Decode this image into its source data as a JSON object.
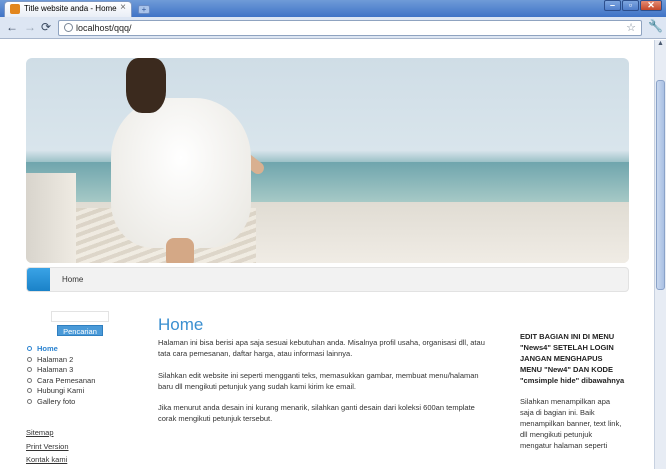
{
  "browser": {
    "tab_title": "Title website anda - Home",
    "tab_close": "×",
    "new_tab": "+",
    "url": "localhost/qqq/",
    "back": "←",
    "forward": "→",
    "reload": "⟳",
    "star": "☆",
    "wrench": "🔧",
    "min": "–",
    "max": "▫",
    "close": "✕"
  },
  "breadcrumb": {
    "label": "Home"
  },
  "sidebar": {
    "search_button": "Pencarian",
    "menu": [
      {
        "label": "Home",
        "active": true
      },
      {
        "label": "Halaman 2",
        "active": false
      },
      {
        "label": "Halaman 3",
        "active": false
      },
      {
        "label": "Cara Pemesanan",
        "active": false
      },
      {
        "label": "Hubungi Kami",
        "active": false
      },
      {
        "label": "Gallery foto",
        "active": false
      }
    ],
    "links": [
      "Sitemap",
      "Print Version",
      "Kontak kami"
    ]
  },
  "main": {
    "title": "Home",
    "paragraphs": [
      "Halaman ini bisa berisi apa saja sesuai kebutuhan anda. Misalnya profil usaha, organisasi dll, atau tata cara pemesanan, daftar harga, atau informasi lainnya.",
      "Silahkan edit website ini seperti mengganti teks, memasukkan gambar, membuat menu/halaman baru dll mengikuti petunjuk yang sudah kami kirim ke email.",
      "Jika menurut anda desain ini kurang menarik, silahkan ganti desain dari koleksi 600an template corak mengikuti petunjuk tersebut."
    ]
  },
  "right": {
    "notice": "EDIT BAGIAN INI DI MENU \"News4\" SETELAH LOGIN JANGAN MENGHAPUS MENU \"New4\" DAN KODE \"cmsimple hide\" dibawahnya",
    "text": "Silahkan menampilkan apa saja di bagian ini. Baik menampilkan banner, text link, dll mengikuti petunjuk mengatur halaman seperti"
  },
  "colors": {
    "accent": "#3a8fd0",
    "titlebar": "#3f73c6"
  }
}
